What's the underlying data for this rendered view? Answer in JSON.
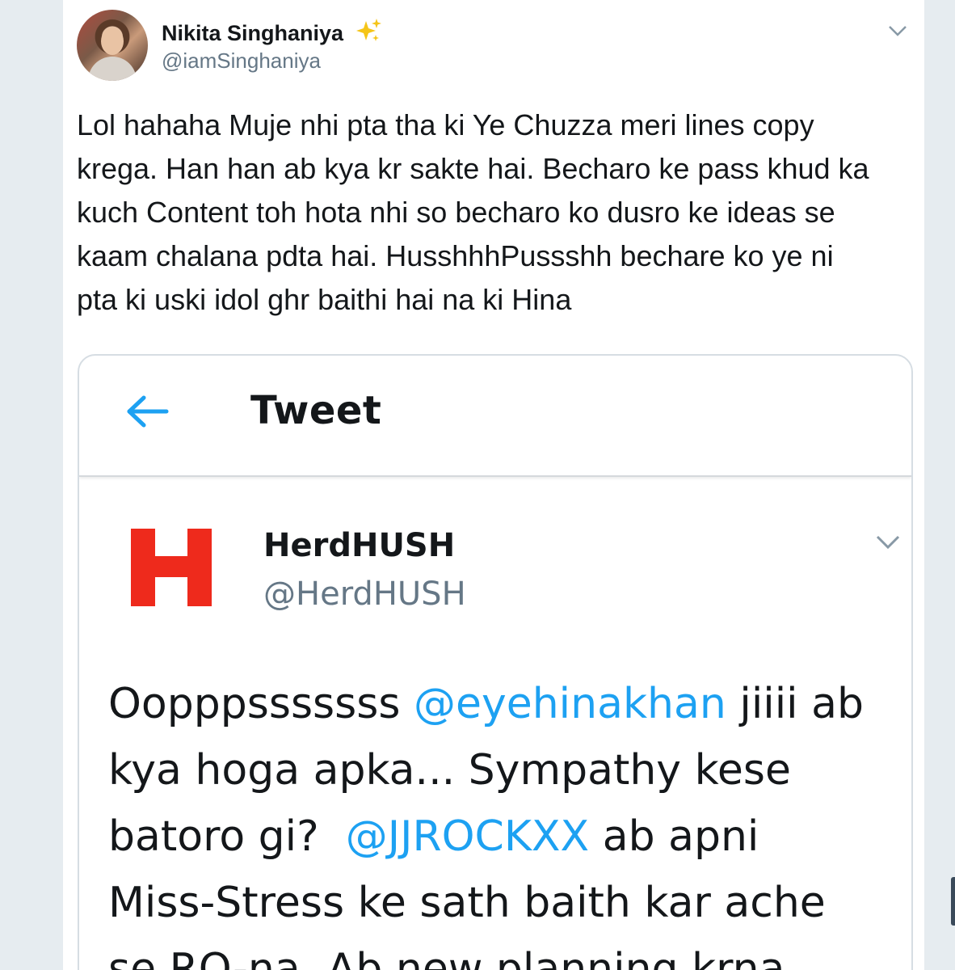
{
  "colors": {
    "background": "#e6ecf0",
    "text": "#14171a",
    "secondary_text": "#657786",
    "link": "#1da1f2",
    "logo_red": "#ee2a1c"
  },
  "tweet": {
    "author_name": "Nikita Singhaniya",
    "author_badge_icon": "sparkles-icon",
    "author_handle": "@iamSinghaniya",
    "text_lines": [
      "Lol hahaha Muje nhi pta tha ki Ye Chuzza meri lines copy",
      "krega. Han han ab kya kr sakte hai. Becharo ke pass khud ka",
      "kuch Content toh hota nhi so becharo ko dusro ke ideas se",
      "kaam chalana pdta hai. HusshhhPussshh bechare ko ye ni",
      "pta ki uski idol ghr baithi hai na ki Hina"
    ]
  },
  "quoted_screenshot": {
    "header_title": "Tweet",
    "author_name": "HerdHUSH",
    "author_handle": "@HerdHUSH",
    "logo_letter": "H",
    "text": {
      "line1_before": "Oopppsssssss ",
      "mention1": "@eyehinakhan",
      "line1_after": " jiiii ab",
      "line2": "kya hoga apka... Sympathy kese",
      "line3_before": "batoro gi?  ",
      "mention2": "@JJROCKXX",
      "line3_after": " ab apni",
      "line4": "Miss-Stress ke sath baith kar ache",
      "line5": "se RO-na. Ab new planning krna."
    }
  }
}
